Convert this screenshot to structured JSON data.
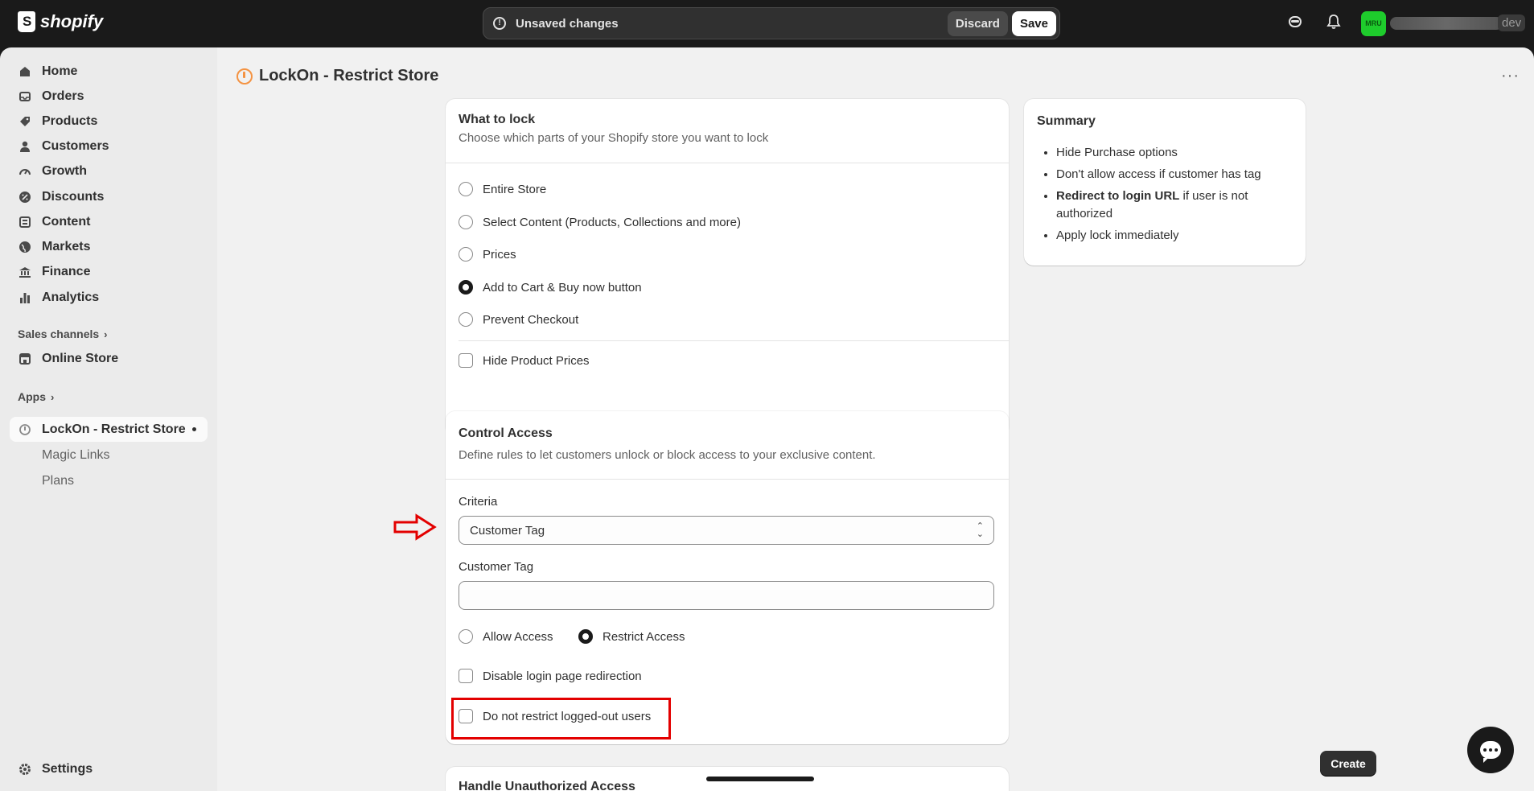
{
  "topbar": {
    "brand": "shopify",
    "unsaved_text": "Unsaved changes",
    "discard_label": "Discard",
    "save_label": "Save",
    "avatar_initials": "MRU",
    "store_tag": "dev"
  },
  "sidebar": {
    "items": [
      {
        "label": "Home",
        "icon": "home-icon"
      },
      {
        "label": "Orders",
        "icon": "inbox-icon"
      },
      {
        "label": "Products",
        "icon": "tag-icon"
      },
      {
        "label": "Customers",
        "icon": "person-icon"
      },
      {
        "label": "Growth",
        "icon": "gauge-icon"
      },
      {
        "label": "Discounts",
        "icon": "discount-icon"
      },
      {
        "label": "Content",
        "icon": "content-icon"
      },
      {
        "label": "Markets",
        "icon": "globe-icon"
      },
      {
        "label": "Finance",
        "icon": "bank-icon"
      },
      {
        "label": "Analytics",
        "icon": "bar-chart-icon"
      }
    ],
    "sales_channels_label": "Sales channels",
    "online_store_label": "Online Store",
    "apps_label": "Apps",
    "app_name": "LockOn - Restrict Store",
    "app_subitems": [
      "Magic Links",
      "Plans"
    ],
    "settings_label": "Settings"
  },
  "page": {
    "title": "LockOn - Restrict Store"
  },
  "what_to_lock": {
    "heading": "What to lock",
    "subheading": "Choose which parts of your Shopify store you want to lock",
    "options": [
      {
        "label": "Entire Store",
        "selected": false
      },
      {
        "label": "Select Content (Products, Collections and more)",
        "selected": false
      },
      {
        "label": "Prices",
        "selected": false
      },
      {
        "label": "Add to Cart & Buy now button",
        "selected": true
      },
      {
        "label": "Prevent Checkout",
        "selected": false
      }
    ],
    "hide_prices_label": "Hide Product Prices"
  },
  "control_access": {
    "heading": "Control Access",
    "subheading": "Define rules to let customers unlock or block access to your exclusive content.",
    "criteria_label": "Criteria",
    "criteria_value": "Customer Tag",
    "customer_tag_label": "Customer Tag",
    "customer_tag_value": "",
    "allow_label": "Allow Access",
    "restrict_label": "Restrict Access",
    "restrict_selected": true,
    "disable_redirect_label": "Disable login page redirection",
    "logged_out_label": "Do not restrict logged-out users"
  },
  "handle_unauthorized": {
    "heading": "Handle Unauthorized Access"
  },
  "summary": {
    "heading": "Summary",
    "items": [
      {
        "plain": "Hide Purchase options"
      },
      {
        "plain": "Don't allow access if customer has tag"
      },
      {
        "bold": "Redirect to login URL",
        "plain": " if user is not authorized"
      },
      {
        "plain": "Apply lock immediately"
      }
    ]
  },
  "footer": {
    "create_label": "Create"
  },
  "colors": {
    "annotation": "#e30000",
    "avatar": "#1ecc2c",
    "app_icon": "#f49342"
  }
}
